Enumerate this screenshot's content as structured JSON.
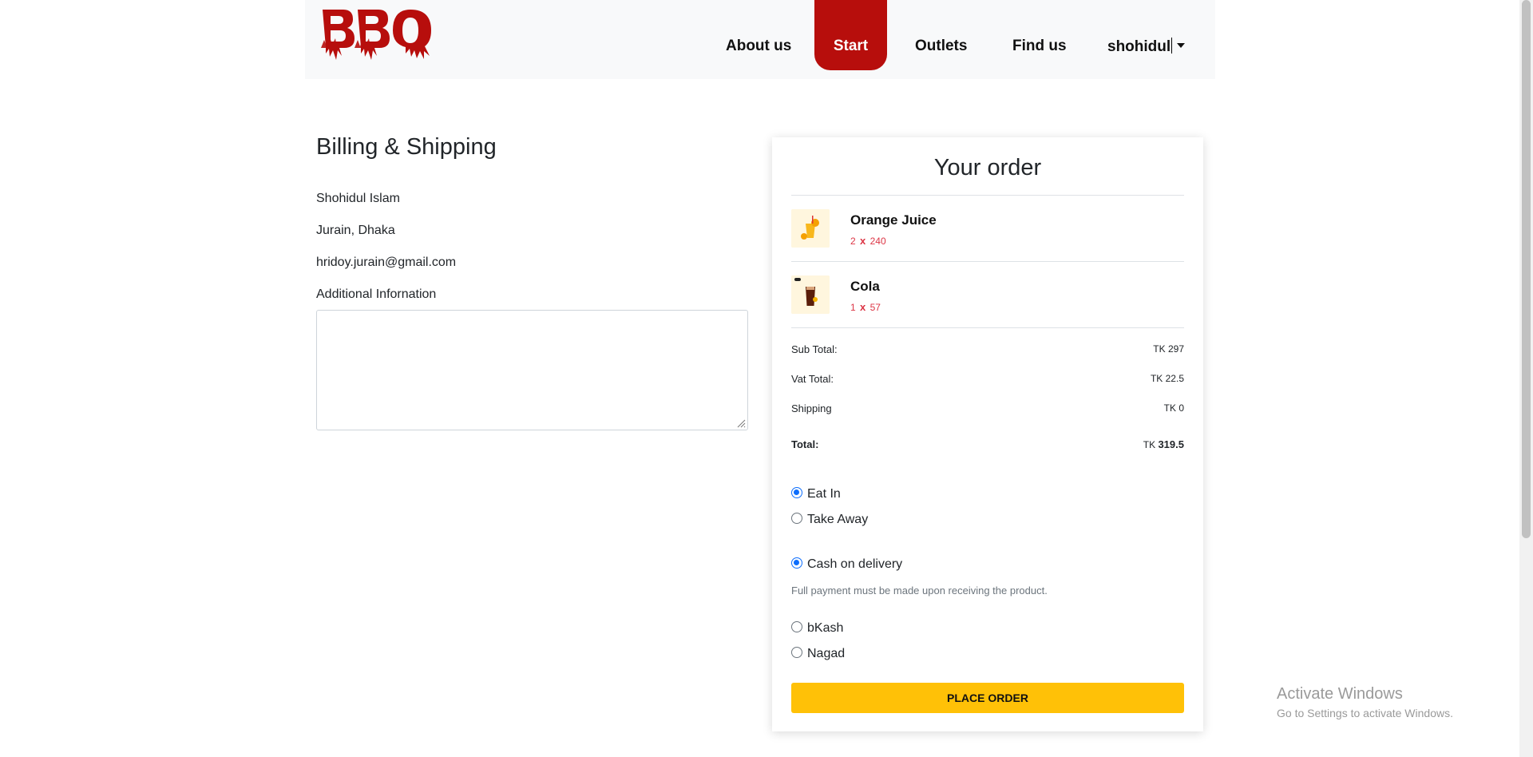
{
  "header": {
    "logo_text": "BBQ",
    "nav": {
      "about": "About us",
      "start": "Start",
      "outlets": "Outlets",
      "find": "Find us",
      "user": "shohidul"
    }
  },
  "billing": {
    "title": "Billing & Shipping",
    "name": "Shohidul Islam",
    "address": "Jurain, Dhaka",
    "email": "hridoy.jurain@gmail.com",
    "additional_label": "Additional Infornation",
    "additional_value": ""
  },
  "order": {
    "title": "Your order",
    "items": [
      {
        "name": "Orange Juice",
        "qty": "2",
        "times": "x",
        "price": "240"
      },
      {
        "name": "Cola",
        "qty": "1",
        "times": "x",
        "price": "57"
      }
    ],
    "subtotal_label": "Sub Total:",
    "subtotal_value": "TK 297",
    "vat_label": "Vat Total:",
    "vat_value": "TK 22.5",
    "shipping_label": "Shipping",
    "shipping_value": "TK 0",
    "total_label": "Total:",
    "total_currency": "TK",
    "total_value": "319.5",
    "dining": {
      "eat_in": "Eat In",
      "take_away": "Take Away",
      "selected": "Eat In"
    },
    "payment": {
      "cod": "Cash on delivery",
      "cod_note": "Full payment must be made upon receiving the product.",
      "bkash": "bKash",
      "nagad": "Nagad",
      "selected": "Cash on delivery"
    },
    "place_order": "Place order"
  },
  "watermark": {
    "title": "Activate Windows",
    "subtitle": "Go to Settings to activate Windows."
  },
  "colors": {
    "brand_red": "#b70e0c",
    "accent_yellow": "#ffc107",
    "radio_blue": "#0d6efd",
    "price_red": "#dc3545"
  }
}
